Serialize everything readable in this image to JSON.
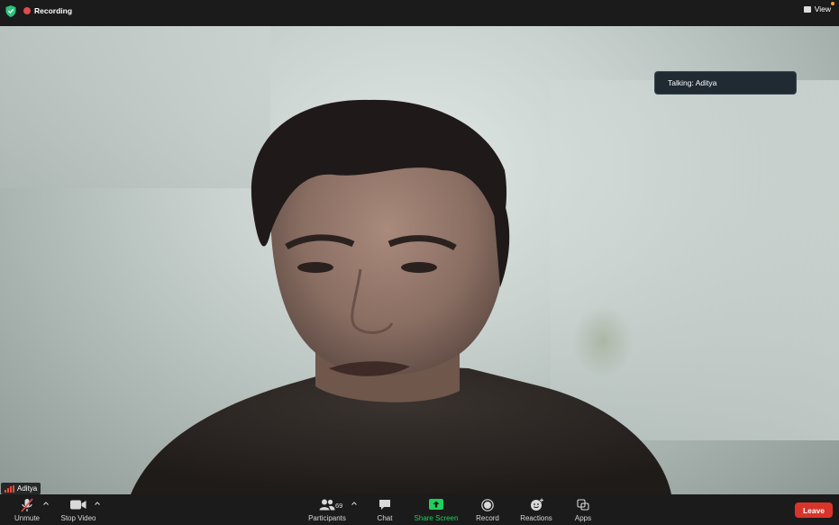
{
  "topbar": {
    "recording_label": "Recording",
    "view_label": "View"
  },
  "banner": {
    "talking": "Talking: Aditya"
  },
  "participant": {
    "name": "Aditya"
  },
  "toolbar": {
    "unmute": "Unmute",
    "stop_video": "Stop Video",
    "participants": "Participants",
    "participants_count": "69",
    "chat": "Chat",
    "share_screen": "Share Screen",
    "record": "Record",
    "reactions": "Reactions",
    "apps": "Apps",
    "leave": "Leave"
  },
  "colors": {
    "recording_dot": "#e34a4a",
    "share_green": "#1fcf5b",
    "leave_red": "#d9342a",
    "shield_green": "#2ec27e"
  }
}
